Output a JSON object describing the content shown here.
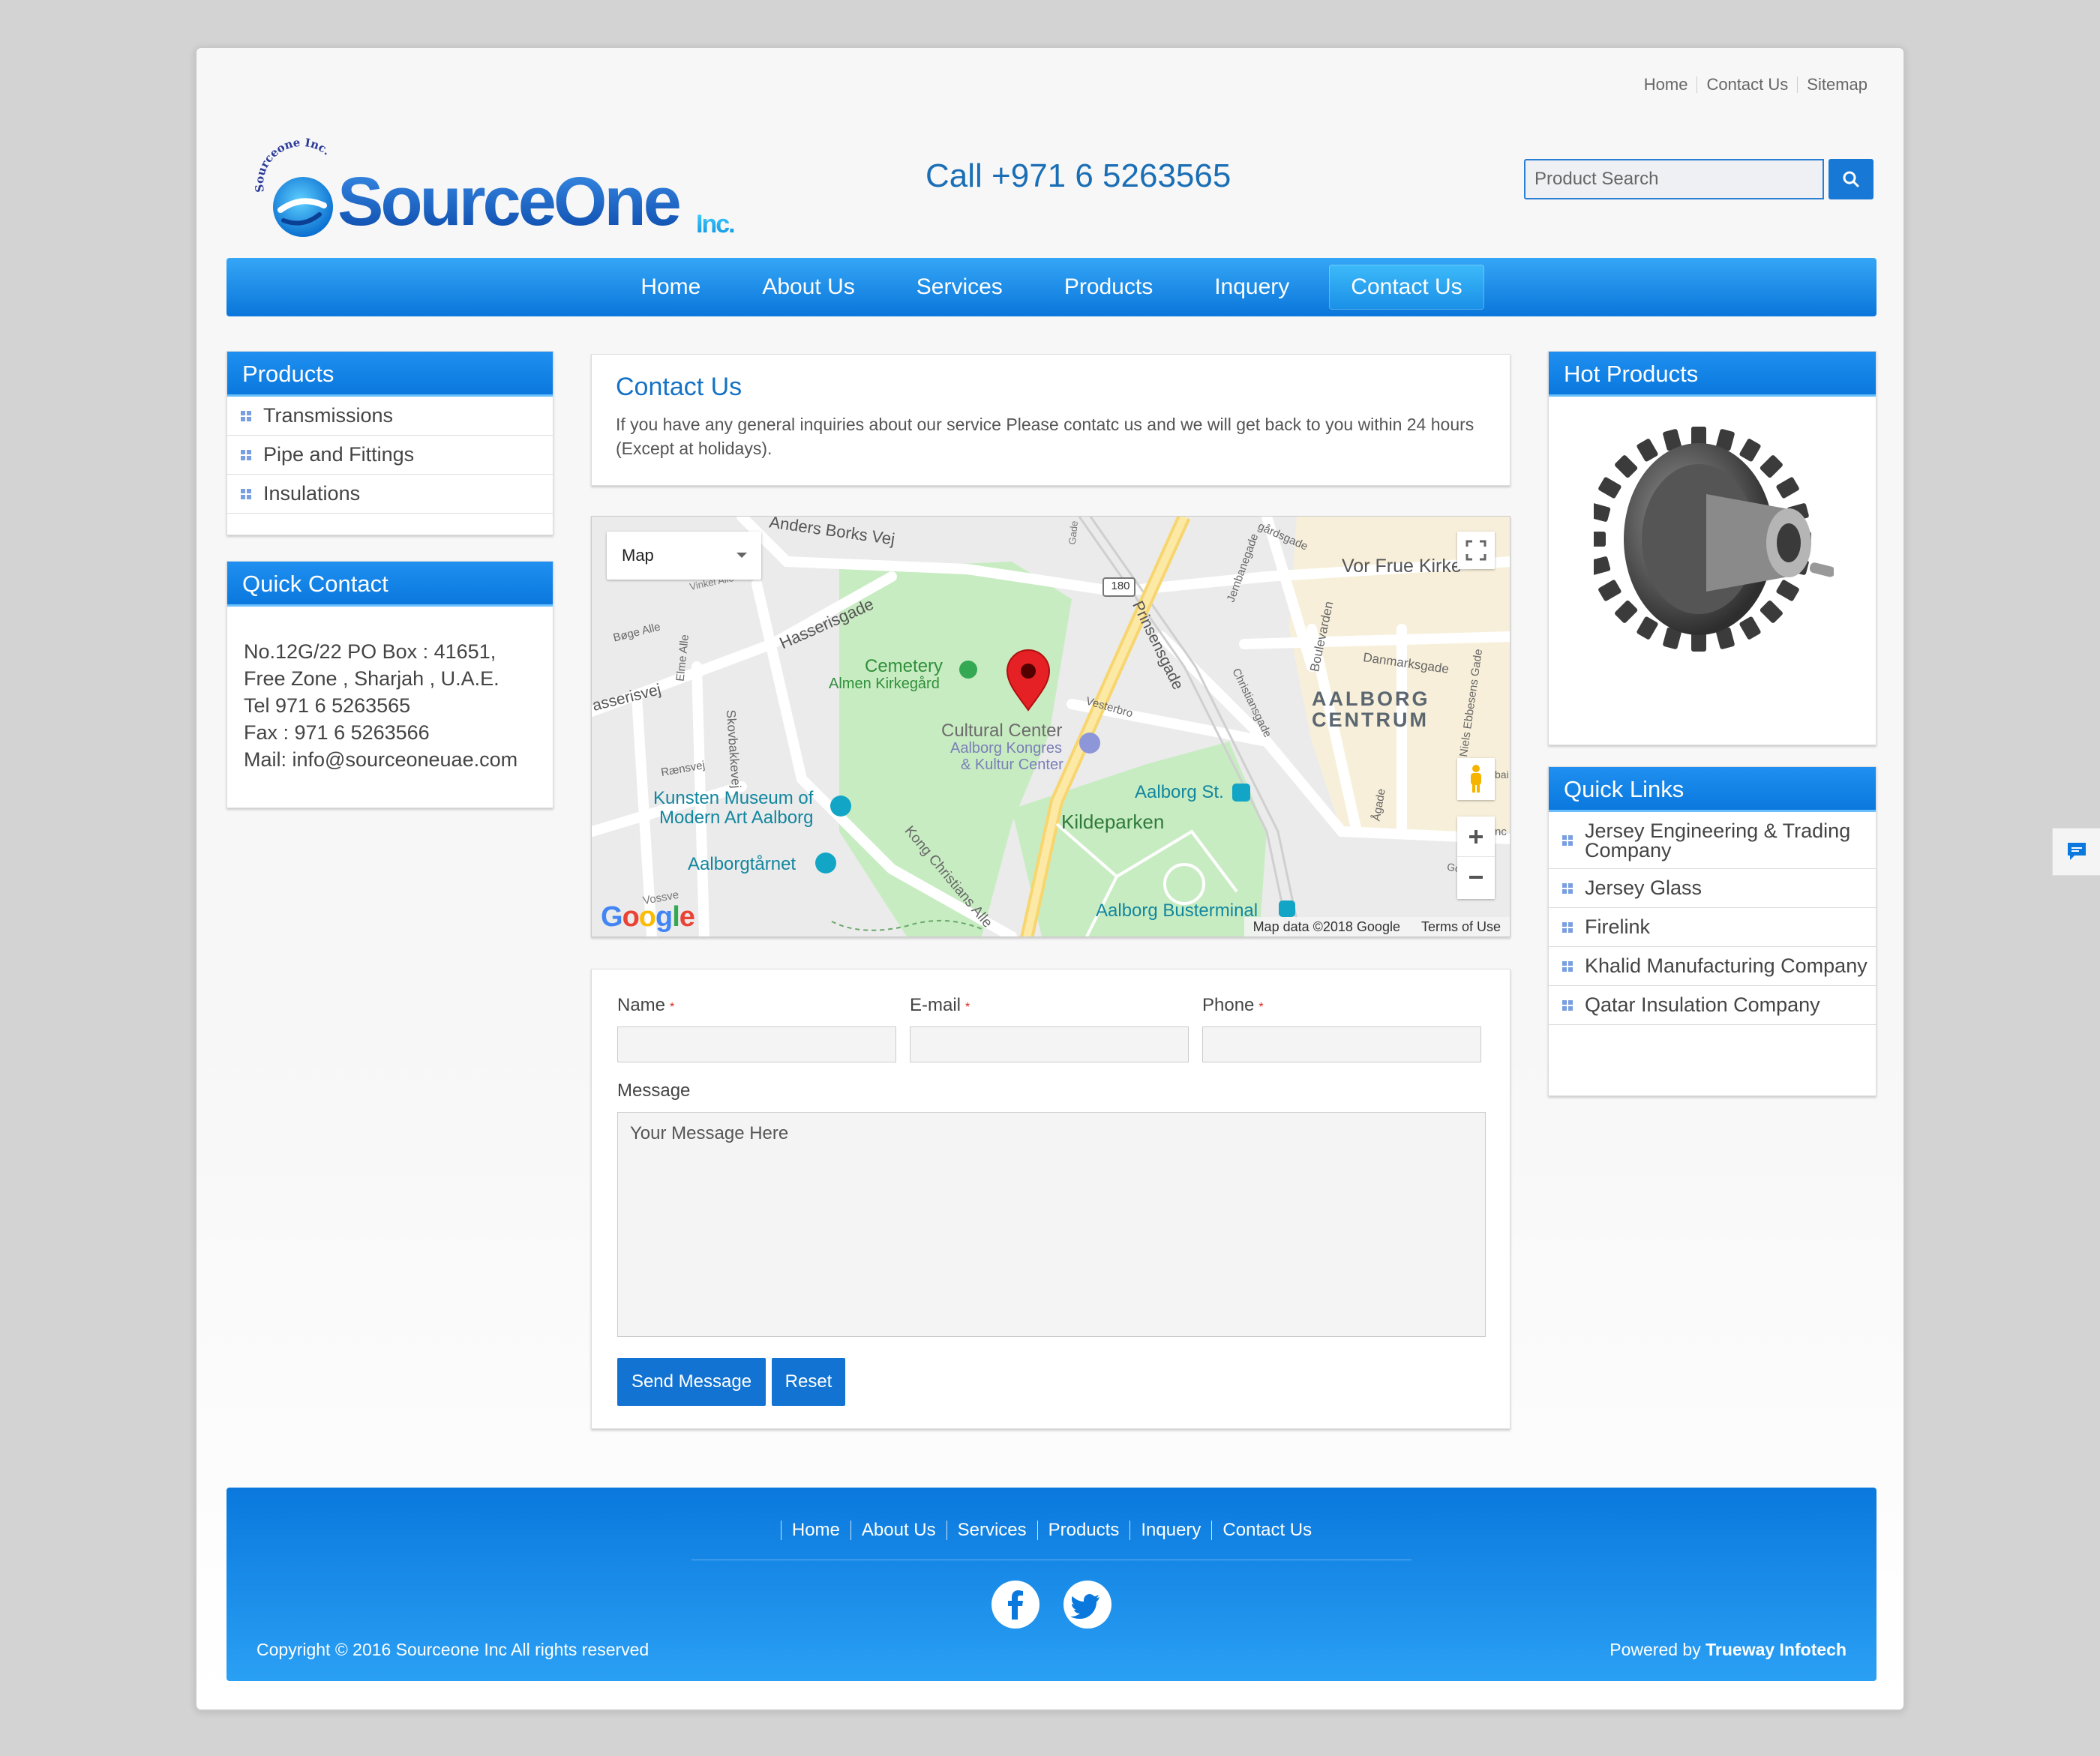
{
  "top_links": [
    "Home",
    "Contact Us",
    "Sitemap"
  ],
  "logo": {
    "brand": "SourceOne",
    "suffix": "Inc.",
    "ring_text": "Sourceone Inc."
  },
  "call_text": "Call +971 6 5263565",
  "search": {
    "placeholder": "Product Search"
  },
  "nav": {
    "items": [
      "Home",
      "About Us",
      "Services",
      "Products",
      "Inquery",
      "Contact Us"
    ],
    "active": "Contact Us"
  },
  "sidebar_products": {
    "title": "Products",
    "items": [
      "Transmissions",
      "Pipe and Fittings",
      "Insulations"
    ]
  },
  "quick_contact": {
    "title": "Quick Contact",
    "lines": [
      "No.12G/22 PO Box : 41651,",
      "Free Zone , Sharjah , U.A.E.",
      "Tel 971 6 5263565",
      "Fax : 971 6 5263566",
      "Mail: info@sourceoneuae.com"
    ]
  },
  "contact": {
    "title": "Contact Us",
    "intro": "If you have any general inquiries about our service Please contatc us and we will get back to you within 24 hours (Except at holidays)."
  },
  "map": {
    "type_select": "Map",
    "labels": {
      "anders": "Anders Borks Vej",
      "vinkel": "Vinkel Alle",
      "hasserisgade": "Hasserisgade",
      "bogealle": "Bøge Alle",
      "elmealle": "Elme Alle",
      "asserisvej": "asserisvej",
      "skovbakkevej": "Skovbakkevej",
      "raensvej": "Rænsvej",
      "cemetery": "Cemetery",
      "almen": "Almen Kirkegård",
      "cultural": "Cultural Center",
      "kongres1": "Aalborg Kongres",
      "kongres2": "& Kultur Center",
      "vesterbro": "Vesterbro",
      "kunsten1": "Kunsten Museum of",
      "kunsten2": "Modern Art Aalborg",
      "taarnet": "Aalborgtårnet",
      "kong": "Kong Christians Alle",
      "vossve": "Vossve",
      "kildeparken": "Kildeparken",
      "aalborgst": "Aalborg St.",
      "busterminal": "Aalborg Busterminal",
      "centrum1": "AALBORG",
      "centrum2": "CENTRUM",
      "vorfrue": "Vor Frue Kirke",
      "prinsensgade": "Prinsensgade",
      "jernbanegade": "Jernbanegade",
      "gaardsgade": "gårdsgade",
      "boulevarden": "Boulevarden",
      "danmarksgade": "Danmarksgade",
      "christiansgade": "Christiansgade",
      "ebbesens": "Niels Ebbesens Gade",
      "agade": "Ågade",
      "godsbane": "Godsbane",
      "route": "180",
      "gade": "Gade",
      "bai": "bai",
      "nc": "nc"
    },
    "google": "Google",
    "attribution": "Map data ©2018 Google",
    "terms": "Terms of Use"
  },
  "form": {
    "name_label": "Name",
    "email_label": "E-mail",
    "phone_label": "Phone",
    "required_mark": "*",
    "message_label": "Message",
    "message_placeholder": "Your Message Here",
    "send_label": "Send Message",
    "reset_label": "Reset"
  },
  "hot_products": {
    "title": "Hot Products"
  },
  "quick_links": {
    "title": "Quick Links",
    "items": [
      "Jersey Engineering & Trading Company",
      "Jersey Glass",
      "Firelink",
      "Khalid Manufacturing Company",
      "Qatar Insulation Company"
    ]
  },
  "footer": {
    "nav": [
      "Home",
      "About Us",
      "Services",
      "Products",
      "Inquery",
      "Contact Us"
    ],
    "copyright": "Copyright © 2016 Sourceone Inc All rights reserved",
    "powered_prefix": "Powered by",
    "powered_name": "Trueway Infotech"
  },
  "colors": {
    "brand_blue": "#0a78dd",
    "link_blue": "#1572c5",
    "required": "#d22"
  }
}
